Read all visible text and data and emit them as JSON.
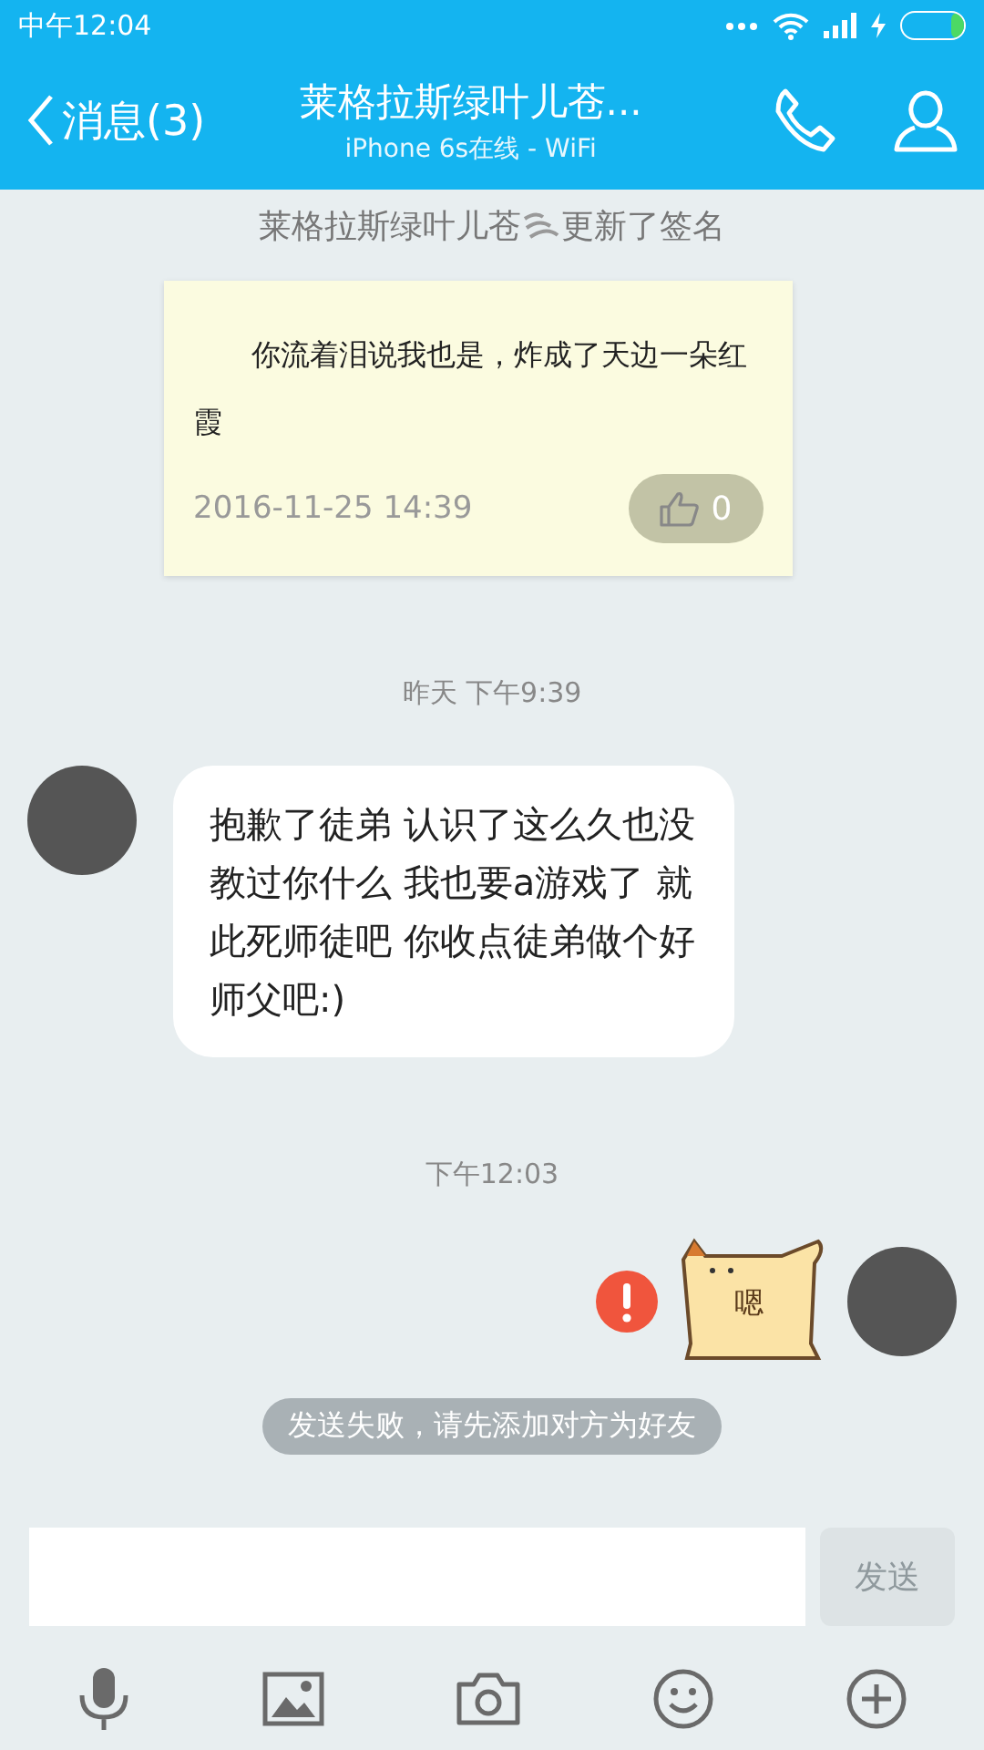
{
  "status_bar": {
    "time": "中午12:04"
  },
  "header": {
    "back_label": "消息(3)",
    "title": "莱格拉斯绿叶儿苍...",
    "subtitle": "iPhone 6s在线 - WiFi"
  },
  "signature_notice": {
    "name": "莱格拉斯绿叶儿苍",
    "action": "更新了签名"
  },
  "signature_card": {
    "text": "你流着泪说我也是，炸成了天边一朵红霞",
    "date": "2016-11-25 14:39",
    "likes": "0"
  },
  "messages": [
    {
      "kind": "time",
      "text": "昨天 下午9:39"
    },
    {
      "kind": "incoming",
      "text": "抱歉了徒弟 认识了这么久也没教过你什么 我也要a游戏了 就此死师徒吧 你收点徒弟做个好师父吧:)"
    },
    {
      "kind": "time",
      "text": "下午12:03"
    },
    {
      "kind": "outgoing_sticker",
      "sticker_text": "嗯",
      "failed": true
    },
    {
      "kind": "system",
      "text": "发送失败，请先添加对方为好友"
    }
  ],
  "input": {
    "send_label": "发送",
    "send_disabled": true
  }
}
